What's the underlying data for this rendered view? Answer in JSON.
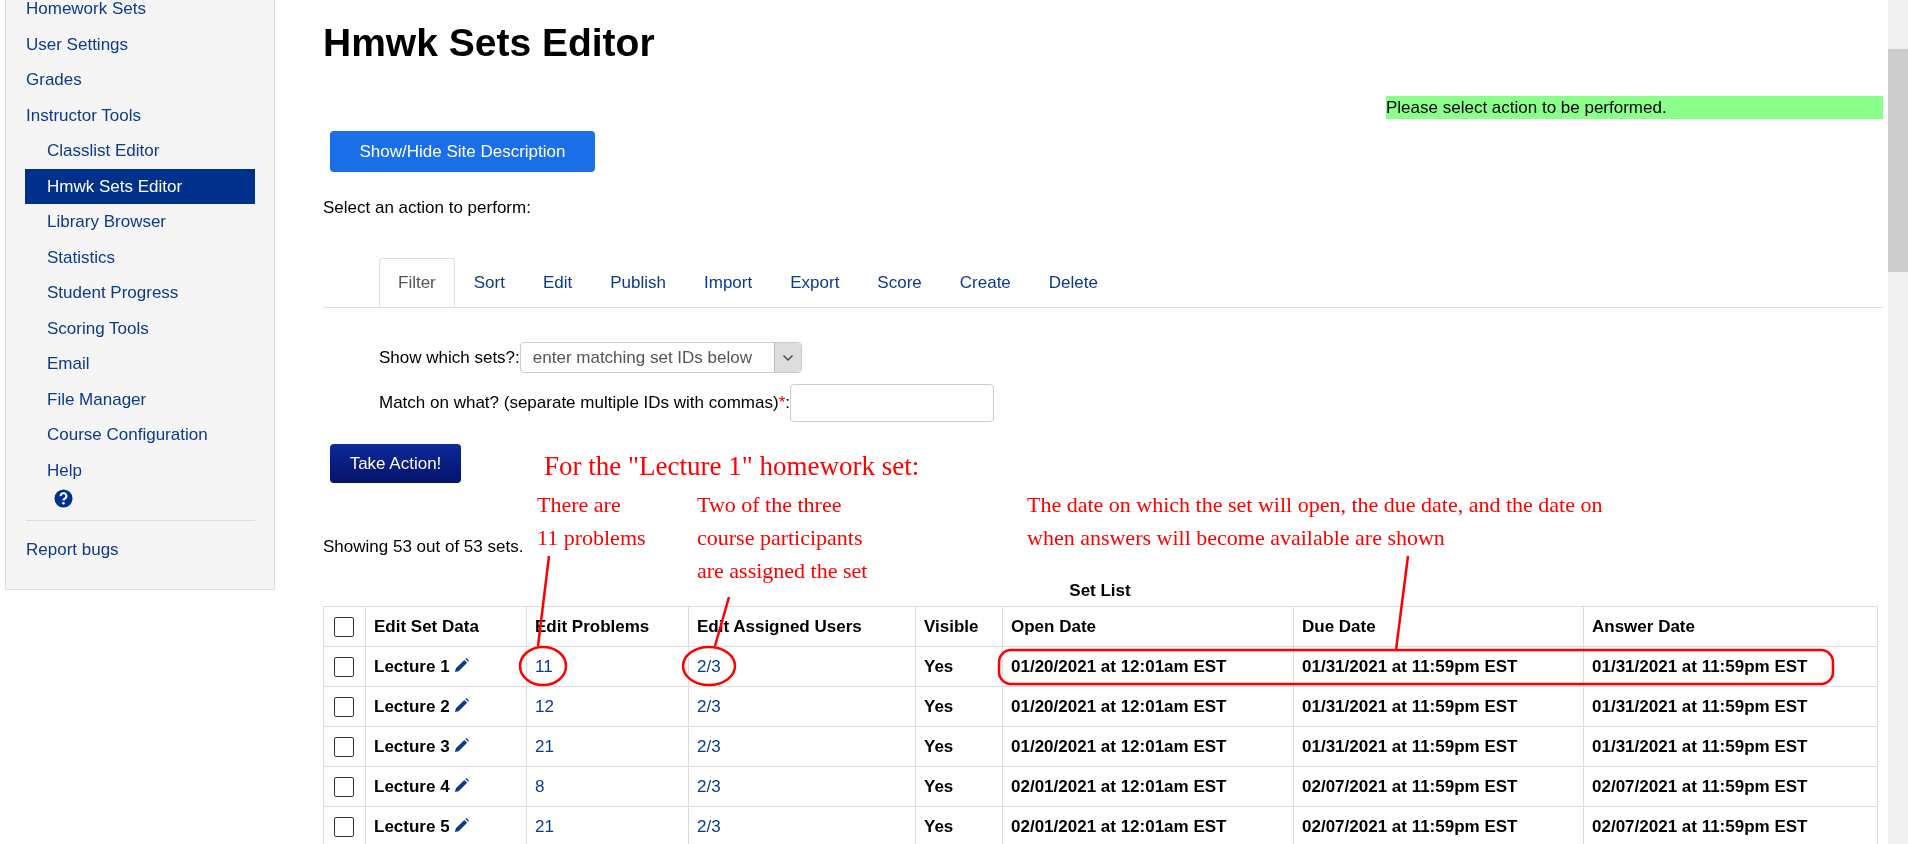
{
  "sidebar": {
    "items": [
      {
        "label": "Homework Sets",
        "selected": false
      },
      {
        "label": "User Settings",
        "selected": false
      },
      {
        "label": "Grades",
        "selected": false
      },
      {
        "label": "Instructor Tools",
        "selected": false,
        "children": [
          {
            "label": "Classlist Editor",
            "selected": false
          },
          {
            "label": "Hmwk Sets Editor",
            "selected": true
          },
          {
            "label": "Library Browser",
            "selected": false
          },
          {
            "label": "Statistics",
            "selected": false
          },
          {
            "label": "Student Progress",
            "selected": false
          },
          {
            "label": "Scoring Tools",
            "selected": false
          },
          {
            "label": "Email",
            "selected": false
          },
          {
            "label": "File Manager",
            "selected": false
          },
          {
            "label": "Course Configuration",
            "selected": false
          },
          {
            "label": "Help",
            "selected": false
          }
        ]
      }
    ],
    "footer_link": "Report bugs"
  },
  "page_title": "Hmwk Sets Editor",
  "message": "Please select action to be performed.",
  "site_description_button": "Show/Hide Site Description",
  "action_prompt": "Select an action to perform:",
  "tabs": [
    {
      "label": "Filter",
      "selected": true
    },
    {
      "label": "Sort",
      "selected": false
    },
    {
      "label": "Edit",
      "selected": false
    },
    {
      "label": "Publish",
      "selected": false
    },
    {
      "label": "Import",
      "selected": false
    },
    {
      "label": "Export",
      "selected": false
    },
    {
      "label": "Score",
      "selected": false
    },
    {
      "label": "Create",
      "selected": false
    },
    {
      "label": "Delete",
      "selected": false
    }
  ],
  "filter": {
    "show_label": "Show which sets?:",
    "show_value": "enter matching set IDs below",
    "match_label": "Match on what? (separate multiple IDs with commas)",
    "required_mark": "*",
    "match_label_end": ":"
  },
  "take_action_button": "Take Action!",
  "showing": "Showing 53 out of 53 sets.",
  "table": {
    "caption": "Set List",
    "header_checked": false,
    "columns": [
      "Edit Set Data",
      "Edit Problems",
      "Edit Assigned Users",
      "Visible",
      "Open Date",
      "Due Date",
      "Answer Date"
    ],
    "rows": [
      {
        "checked": false,
        "name": "Lecture 1",
        "problems": "11",
        "users": "2/3",
        "visible": "Yes",
        "open": "01/20/2021 at 12:01am EST",
        "due": "01/31/2021 at 11:59pm EST",
        "answer": "01/31/2021 at 11:59pm EST"
      },
      {
        "checked": false,
        "name": "Lecture 2",
        "problems": "12",
        "users": "2/3",
        "visible": "Yes",
        "open": "01/20/2021 at 12:01am EST",
        "due": "01/31/2021 at 11:59pm EST",
        "answer": "01/31/2021 at 11:59pm EST"
      },
      {
        "checked": false,
        "name": "Lecture 3",
        "problems": "21",
        "users": "2/3",
        "visible": "Yes",
        "open": "01/20/2021 at 12:01am EST",
        "due": "01/31/2021 at 11:59pm EST",
        "answer": "01/31/2021 at 11:59pm EST"
      },
      {
        "checked": false,
        "name": "Lecture 4",
        "problems": "8",
        "users": "2/3",
        "visible": "Yes",
        "open": "02/01/2021 at 12:01am EST",
        "due": "02/07/2021 at 11:59pm EST",
        "answer": "02/07/2021 at 11:59pm EST"
      },
      {
        "checked": false,
        "name": "Lecture 5",
        "problems": "21",
        "users": "2/3",
        "visible": "Yes",
        "open": "02/01/2021 at 12:01am EST",
        "due": "02/07/2021 at 11:59pm EST",
        "answer": "02/07/2021 at 11:59pm EST"
      }
    ]
  },
  "annotations": [
    {
      "kind": "heading",
      "lines": [
        "For the \"Lecture 1\" homework set:"
      ]
    },
    {
      "kind": "note",
      "lines": [
        "There are",
        "11 problems"
      ]
    },
    {
      "kind": "note",
      "lines": [
        "Two of the three",
        "course participants",
        "are assigned the set"
      ]
    },
    {
      "kind": "note",
      "lines": [
        "The date on which the set will open, the due date, and the date on",
        "when answers will become available are shown"
      ]
    }
  ]
}
